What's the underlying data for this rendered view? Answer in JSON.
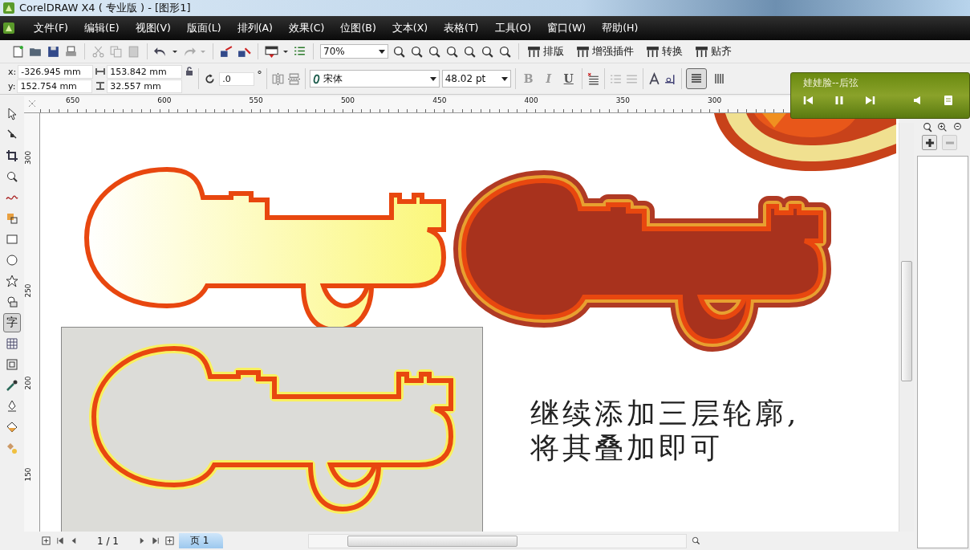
{
  "window": {
    "title": "CorelDRAW X4 ( 专业版 ) - [图形1]"
  },
  "menu": [
    "文件(F)",
    "编辑(E)",
    "视图(V)",
    "版面(L)",
    "排列(A)",
    "效果(C)",
    "位图(B)",
    "文本(X)",
    "表格(T)",
    "工具(O)",
    "窗口(W)",
    "帮助(H)"
  ],
  "toolbar": {
    "zoom": "70%",
    "plugins": [
      "排版",
      "增强插件",
      "转换",
      "贴齐"
    ]
  },
  "property_bar": {
    "x_label": "x:",
    "x": "-326.945 mm",
    "y_label": "y:",
    "y": "152.754 mm",
    "width": "153.842 mm",
    "height": "32.557 mm",
    "rotation": ".0",
    "degree": "°",
    "font": "宋体",
    "font_size": "48.02 pt",
    "styles": [
      {
        "glyph": "B",
        "disabled": true
      },
      {
        "glyph": "I",
        "disabled": true
      },
      {
        "glyph": "U",
        "disabled": false
      }
    ],
    "text_direction": [
      {
        "kind": "horizontal",
        "selected": true
      },
      {
        "kind": "vertical",
        "selected": false
      }
    ]
  },
  "toolbox": [
    {
      "kind": "pointer",
      "selected": false
    },
    {
      "kind": "shape",
      "selected": false
    },
    {
      "kind": "crop",
      "selected": false
    },
    {
      "kind": "zoom",
      "selected": false
    },
    {
      "kind": "freehand",
      "selected": false
    },
    {
      "kind": "smartfill",
      "selected": false
    },
    {
      "kind": "rectangle",
      "selected": false
    },
    {
      "kind": "ellipse",
      "selected": false
    },
    {
      "kind": "star",
      "selected": false
    },
    {
      "kind": "shapes",
      "selected": false
    },
    {
      "kind": "text",
      "label": "字",
      "selected": true
    },
    {
      "kind": "table",
      "selected": false
    },
    {
      "kind": "contour",
      "selected": false
    },
    {
      "kind": "eyedropper",
      "selected": false
    },
    {
      "kind": "outline",
      "selected": false
    },
    {
      "kind": "fill",
      "selected": false
    },
    {
      "kind": "interactive",
      "selected": false
    }
  ],
  "ruler": {
    "horizontal": [
      "650",
      "600",
      "550",
      "500",
      "450",
      "400",
      "350",
      "300"
    ],
    "vertical": [
      "300",
      "250",
      "200",
      "150"
    ]
  },
  "canvas_text": [
    "继续添加三层轮廓,",
    "将其叠加即可"
  ],
  "page_nav": {
    "count": "1 / 1",
    "tab": "页 1"
  },
  "player": {
    "title": "娃娃脸--后弦"
  }
}
